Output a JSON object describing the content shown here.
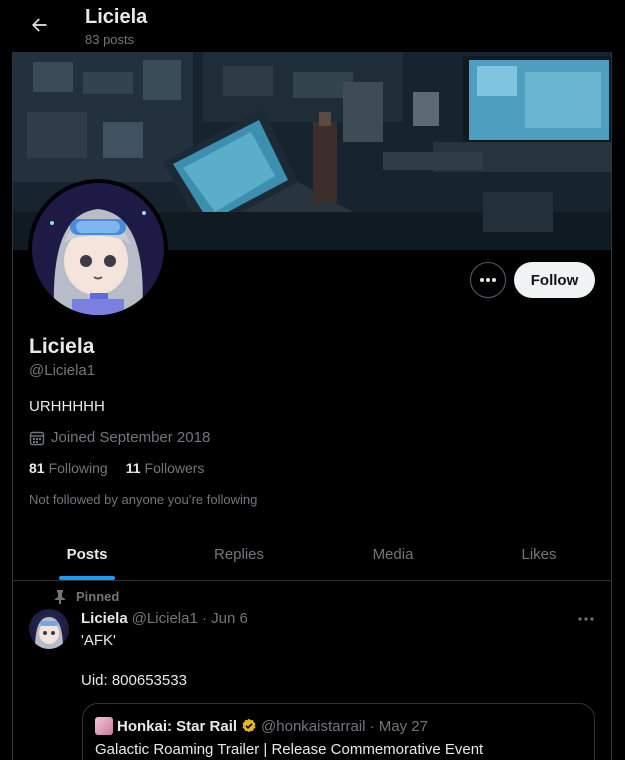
{
  "header": {
    "title": "Liciela",
    "post_count": "83 posts"
  },
  "profile": {
    "display_name": "Liciela",
    "handle": "@Liciela1",
    "bio": "URHHHHH",
    "joined": "Joined September 2018",
    "following_count": "81",
    "following_label": "Following",
    "followers_count": "11",
    "followers_label": "Followers",
    "not_followed_note": "Not followed by anyone you’re following",
    "follow_label": "Follow"
  },
  "tabs": [
    {
      "label": "Posts",
      "active": true
    },
    {
      "label": "Replies",
      "active": false
    },
    {
      "label": "Media",
      "active": false
    },
    {
      "label": "Likes",
      "active": false
    }
  ],
  "post": {
    "pinned_label": "Pinned",
    "author_name": "Liciela",
    "author_meta": "@Liciela1 · Jun 6",
    "line1": "'AFK'",
    "line2": "Uid: 800653533",
    "quote": {
      "author_name": "Honkai: Star Rail",
      "author_meta": "@honkaistarrail · May 27",
      "title": "Galactic Roaming Trailer | Release Commemorative Event"
    }
  },
  "colors": {
    "background": "#000000",
    "text_primary": "#e7e9ea",
    "text_secondary": "#71767b",
    "accent": "#1d9bf0",
    "verified_gold": "#e2b719",
    "border": "#2f3336"
  },
  "icons": {
    "back": "arrow-left-icon",
    "more": "ellipsis-icon",
    "calendar": "calendar-icon",
    "pin": "pin-icon",
    "verified": "verified-badge-icon"
  }
}
